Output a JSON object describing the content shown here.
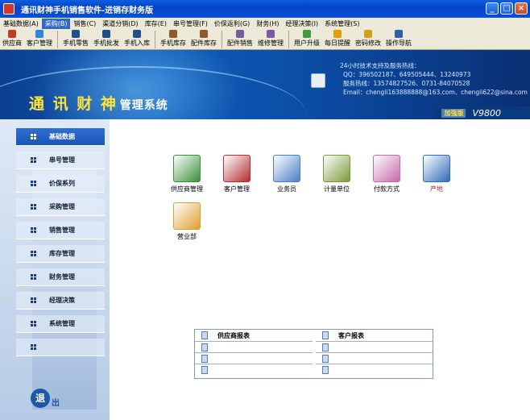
{
  "window": {
    "title": "通讯财神手机销售软件-进销存财务版"
  },
  "menubar": [
    "基础数据(A)",
    "采购(B)",
    "销售(C)",
    "渠道分销(D)",
    "库存(E)",
    "串号管理(F)",
    "价保返利(G)",
    "财务(H)",
    "经理决策(I)",
    "系统管理(S)"
  ],
  "menubar_active": "采购(B)",
  "toolbar": [
    {
      "label": "供应商",
      "icon": "supplier-icon",
      "color": "#c0392b"
    },
    {
      "label": "客户管理",
      "icon": "customer-icon",
      "color": "#2e86de"
    },
    {
      "label": "手机零售",
      "icon": "phone-retail-icon",
      "color": "#1f4e8c"
    },
    {
      "label": "手机批发",
      "icon": "phone-wholesale-icon",
      "color": "#1f4e8c"
    },
    {
      "label": "手机入库",
      "icon": "phone-inbound-icon",
      "color": "#1f4e8c"
    },
    {
      "label": "手机库存",
      "icon": "phone-stock-icon",
      "color": "#8e5a2b"
    },
    {
      "label": "配件库存",
      "icon": "parts-stock-icon",
      "color": "#8e5a2b"
    },
    {
      "label": "配件销售",
      "icon": "parts-sales-icon",
      "color": "#7a5c9e"
    },
    {
      "label": "维修管理",
      "icon": "repair-icon",
      "color": "#7a5c9e"
    },
    {
      "label": "用户升级",
      "icon": "upgrade-icon",
      "color": "#3c9d3c"
    },
    {
      "label": "每日提醒",
      "icon": "reminder-icon",
      "color": "#e69b00"
    },
    {
      "label": "密码修改",
      "icon": "password-icon",
      "color": "#d4a017"
    },
    {
      "label": "操作导航",
      "icon": "navigation-icon",
      "color": "#2e5fa8"
    }
  ],
  "banner": {
    "brand_big": "通 讯 财 神",
    "brand_small": "管理系统",
    "support_lines": [
      "24小时技术支持及服务热线：",
      "QQ：396502187、649505444、13240973",
      "服务热线：13574827526、0731-84070528",
      "Email：chengli163888888@163.com、chengli622@sina.com"
    ],
    "edition_tag": "加强版",
    "version": "V9800"
  },
  "sidebar": [
    {
      "label": "基础数据",
      "active": true
    },
    {
      "label": "串号管理",
      "active": false
    },
    {
      "label": "价保系列",
      "active": false
    },
    {
      "label": "采购管理",
      "active": false
    },
    {
      "label": "销售管理",
      "active": false
    },
    {
      "label": "库存管理",
      "active": false
    },
    {
      "label": "财务管理",
      "active": false
    },
    {
      "label": "经理决策",
      "active": false
    },
    {
      "label": "系统管理",
      "active": false
    },
    {
      "label": "",
      "active": false
    }
  ],
  "exit": {
    "circle": "退",
    "rest": "出"
  },
  "main_icons": [
    {
      "label": "供应商管理",
      "icon": "supplier-book-icon",
      "color": "#3a8f3a",
      "red": false
    },
    {
      "label": "客户管理",
      "icon": "customers-icon",
      "color": "#b03030",
      "red": false
    },
    {
      "label": "业务员",
      "icon": "salesman-folder-icon",
      "color": "#4a7fc4",
      "red": false
    },
    {
      "label": "计量单位",
      "icon": "measure-unit-icon",
      "color": "#7a9a3a",
      "red": false
    },
    {
      "label": "付款方式",
      "icon": "payment-method-icon",
      "color": "#c46aa8",
      "red": false
    },
    {
      "label": "产地",
      "icon": "origin-icon",
      "color": "#2e6bb8",
      "red": true
    },
    {
      "label": "营业部",
      "icon": "business-dept-icon",
      "color": "#e0a030",
      "red": false
    }
  ],
  "reports": {
    "left_title": "供应商报表",
    "right_title": "客户报表"
  }
}
